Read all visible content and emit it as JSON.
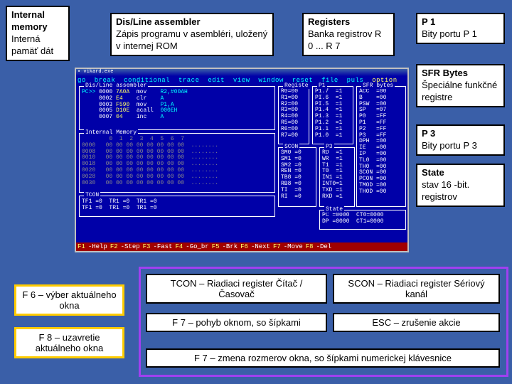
{
  "labels": {
    "internal_mem": {
      "title": "Internal memory",
      "sub": "Interná pamäť dát"
    },
    "disline": {
      "title": "Dis/Line assembler",
      "sub": "Zápis programu v asembléri, uložený v internej ROM"
    },
    "registers": {
      "title": "Registers",
      "sub": "Banka registrov R 0 ... R 7"
    },
    "p1": {
      "title": "P 1",
      "sub": "Bity portu P 1"
    },
    "sfr": {
      "title": "SFR Bytes",
      "sub": "Špeciálne funkčné registre"
    },
    "p3": {
      "title": "P 3",
      "sub": "Bity portu P 3"
    },
    "state": {
      "title": "State",
      "sub": "stav 16 -bit. registrov"
    }
  },
  "menu": [
    "go",
    "break",
    "conditional",
    "trace",
    "edit",
    "view",
    "window",
    "reset",
    "file",
    "puls"
  ],
  "menu_option": "option",
  "disline_title": "Dis/Line assembler",
  "disline_rows": [
    [
      "PC>>",
      "0000",
      "7A0A",
      "mov",
      "R2,#00AH"
    ],
    [
      "",
      "0002",
      "E4",
      "clr",
      "A"
    ],
    [
      "",
      "0003",
      "F590",
      "mov",
      "P1,A"
    ],
    [
      "",
      "0005",
      "D10E",
      "acall",
      "000EH"
    ],
    [
      "",
      "0007",
      "04",
      "inc",
      "A"
    ]
  ],
  "intmem_title": "Internal Memory",
  "intmem_header": " 0  1  2  3  4  5  6  7",
  "intmem_rows": [
    "0000   00 00 00 00 00 00 00 00  ........",
    "0008   00 00 00 00 00 00 00 00  ........",
    "0010   00 00 00 00 00 00 00 00  ........",
    "0018   00 00 00 00 00 00 00 00  ........",
    "0020   00 00 00 00 00 00 00 00  ........",
    "0028   00 00 00 00 00 00 00 00  ........",
    "0030   00 00 00 00 00 00 00 00  ........"
  ],
  "tcon_title": "TCON",
  "tcon_rows": [
    "TF1 =0  TR1 =0  TR1 =0  ",
    "TF1 =0  TR1 =0  TR1 =0  "
  ],
  "reg_title": "Registe",
  "reg_rows": [
    "R0=00",
    "R1=00",
    "R2=00",
    "R3=00",
    "R4=00",
    "R5=00",
    "R6=00",
    "R7=00"
  ],
  "scon_title": "SCON",
  "scon_rows": [
    "SM0 =0",
    "SM1 =0",
    "SM2 =0",
    "REN =0",
    "TB8 =0",
    "RB8 =0",
    "TI  =0",
    "RI  =0"
  ],
  "p1_title": "P1",
  "p1_rows": [
    "P1.7  =1",
    "PI.6  =1",
    "PI.5  =1",
    "P1.4  =1",
    "P1.3  =1",
    "P1.2  =1",
    "P1.1  =1",
    "P1.0  =1"
  ],
  "p3_title": "P3",
  "p3_rows": [
    "RD  =1",
    "WR  =1",
    "T1  =1",
    "T0  =1",
    "IN1 =1",
    "INT0=1",
    "TXD =1",
    "RXD =1"
  ],
  "sfr_title": "SFR bytes",
  "sfr_rows": [
    "ACC  =00",
    "B    =00",
    "PSW  =00",
    "SP   =07",
    "P0   =FF",
    "P1   =FF",
    "P2   =FF",
    "P3   =FF"
  ],
  "sfr2_rows": [
    "DPH  =00",
    "IE   =00",
    "IP   =00",
    "TL0  =00",
    "TH0  =00",
    "SCON =00",
    "PCON =00",
    "TMOD =00",
    "THOD =00"
  ],
  "state_title": "State",
  "state_rows": [
    "PC =0000  CT0=0000",
    "DP =0000  CT1=0000"
  ],
  "fkeys": [
    [
      "F1",
      "Help"
    ],
    [
      "F2",
      "Step"
    ],
    [
      "F3",
      "Fast"
    ],
    [
      "F4",
      "Go_br"
    ],
    [
      "F5",
      "Brk"
    ],
    [
      "F6",
      "Next"
    ],
    [
      "F7",
      "Move"
    ],
    [
      "F8",
      "Del"
    ]
  ],
  "bottom": {
    "f6": "F 6 – výber aktuálneho okna",
    "f8": "F 8 – uzavretie aktuálneho okna",
    "tcon": "TCON – Riadiaci register Čítač / Časovač",
    "scon_b": "SCON – Riadiaci register Sériový kanál",
    "f7a": "F 7 – pohyb oknom, so šípkami",
    "esc": "ESC – zrušenie akcie",
    "f7b": "F 7 – zmena rozmerov okna, so šípkami numerickej klávesnice"
  }
}
